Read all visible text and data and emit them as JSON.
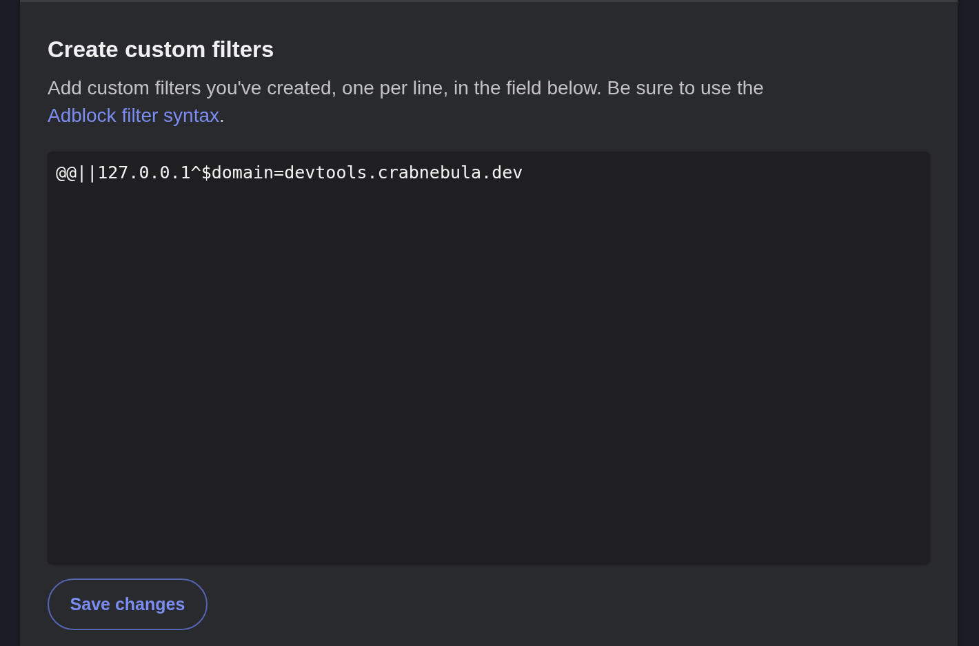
{
  "panel": {
    "title": "Create custom filters",
    "description": {
      "text": "Add custom filters you've created, one per line, in the field below. Be sure to use the ",
      "link": "Adblock filter syntax",
      "text_after": "."
    },
    "filters_field": {
      "value": "@@||127.0.0.1^$domain=devtools.crabnebula.dev"
    },
    "save_button": {
      "label": "Save changes"
    }
  }
}
